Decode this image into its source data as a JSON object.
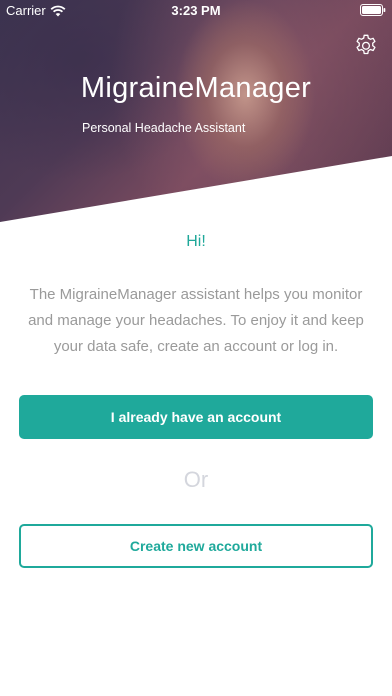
{
  "status_bar": {
    "carrier": "Carrier",
    "time": "3:23 PM",
    "icons": [
      "wifi-icon",
      "battery-icon"
    ]
  },
  "header": {
    "title": "MigraineManager",
    "subtitle": "Personal Headache Assistant",
    "settings_icon": "gear-icon"
  },
  "main": {
    "greeting": "Hi!",
    "intro": "The MigraineManager assistant helps you monitor and manage your headaches. To enjoy it and keep your data safe, create an account or log in.",
    "login_button_label": "I already have an account",
    "separator": "Or",
    "create_button_label": "Create new account"
  },
  "colors": {
    "accent": "#1fa99b",
    "body_text": "#9a9a9a",
    "separator": "#d4d6dd"
  }
}
